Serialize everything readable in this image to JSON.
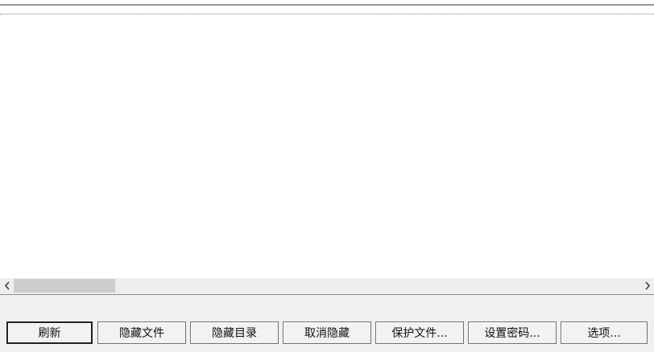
{
  "list": {
    "rows": []
  },
  "scrollbar": {
    "left_arrow_icon": "chevron-left-icon",
    "right_arrow_icon": "chevron-right-icon",
    "position_fraction": 0.0
  },
  "buttons": {
    "refresh": "刷新",
    "hide_file": "隐藏文件",
    "hide_directory": "隐藏目录",
    "unhide": "取消隐藏",
    "protect_file": "保护文件...",
    "set_password": "设置密码...",
    "options": "选项..."
  }
}
